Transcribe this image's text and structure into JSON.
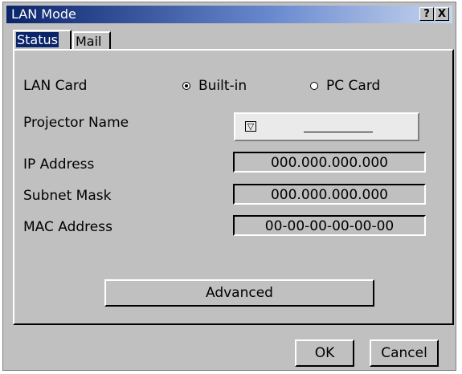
{
  "window": {
    "title": "LAN Mode",
    "help_button": "?",
    "close_button": "X"
  },
  "tabs": [
    {
      "label": "Status",
      "selected": true
    },
    {
      "label": "Mail",
      "selected": false
    }
  ],
  "lan_card": {
    "label": "LAN Card",
    "options": [
      {
        "label": "Built-in",
        "selected": true
      },
      {
        "label": "PC Card",
        "selected": false
      }
    ]
  },
  "projector_name": {
    "label": "Projector Name",
    "value": ""
  },
  "ip_address": {
    "label": "IP Address",
    "value": "000.000.000.000"
  },
  "subnet_mask": {
    "label": "Subnet Mask",
    "value": "000.000.000.000"
  },
  "mac_address": {
    "label": "MAC Address",
    "value": "00-00-00-00-00-00"
  },
  "buttons": {
    "advanced": "Advanced",
    "ok": "OK",
    "cancel": "Cancel"
  },
  "colors": {
    "title_bar": "#0a246a",
    "dialog_face": "#c0c0c0",
    "selected_tab_highlight": "#0a246a"
  },
  "icons": {
    "dropdown": "triangle-down-icon"
  }
}
